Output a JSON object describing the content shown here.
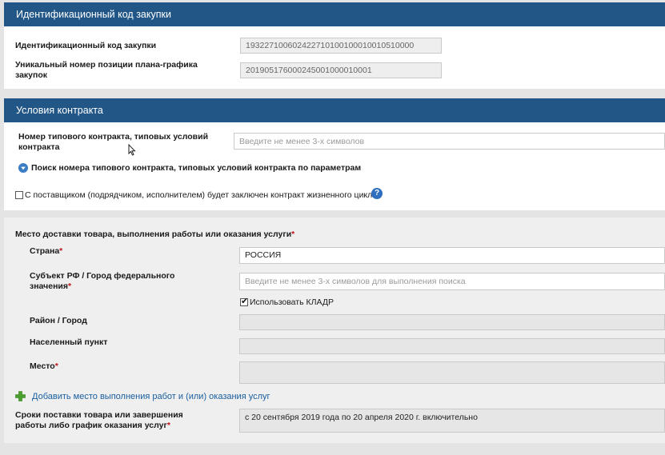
{
  "procurement_id_section": {
    "title": "Идентификационный код закупки",
    "fields": [
      {
        "label": "Идентификационный код закупки",
        "value": "193227100602422710100100010010510000"
      },
      {
        "label": "Уникальный номер позиции плана-графика закупок",
        "value": "201905176000245001000010001"
      }
    ]
  },
  "contract_terms_section": {
    "title": "Условия контракта",
    "typical_contract_label": "Номер типового контракта, типовых условий контракта",
    "typical_contract_placeholder": "Введите не менее 3-х символов",
    "search_link": "Поиск номера типового контракта, типовых условий контракта по параметрам",
    "lifecycle_checkbox_label": "С поставщиком (подрядчиком, исполнителем) будет заключен контракт жизненного цикла",
    "help_icon_glyph": "?"
  },
  "delivery_section": {
    "title": "Место доставки товара, выполнения работы или оказания услуги",
    "required_mark": "*",
    "country_label": "Страна",
    "country_value": "РОССИЯ",
    "region_label": "Субъект РФ / Город федерального значения",
    "region_placeholder": "Введите не менее 3-х символов для выполнения поиска",
    "kladr_label": "Использовать КЛАДР",
    "kladr_checked": true,
    "district_label": "Район / Город",
    "locality_label": "Населенный пункт",
    "place_label": "Место",
    "add_place_link": "Добавить место выполнения работ и (или) оказания услуг",
    "deadline_label": "Сроки поставки товара или завершения работы либо график оказания услуг",
    "deadline_value": "с 20 сентября 2019 года по 20 апреля 2020 г. включительно"
  },
  "colors": {
    "header_bg": "#215687",
    "link": "#1a5fa0",
    "required": "#c0141c",
    "add_icon": "#4aa02c"
  }
}
